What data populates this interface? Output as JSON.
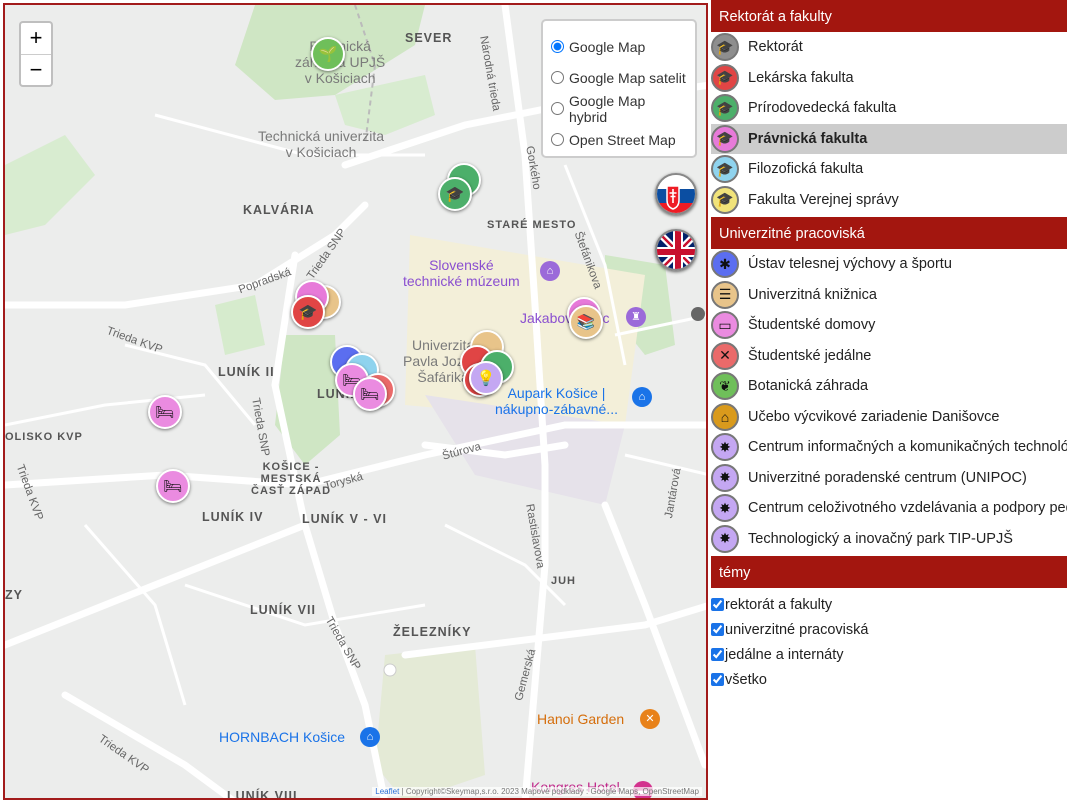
{
  "map": {
    "zoom_in": "+",
    "zoom_out": "−",
    "layers": [
      {
        "label": "Google Map",
        "checked": true
      },
      {
        "label": "Google Map satelit",
        "checked": false
      },
      {
        "label": "Google Map hybrid",
        "checked": false
      },
      {
        "label": "Open Street Map",
        "checked": false
      }
    ],
    "labels": {
      "botanicka": "Botanická\nzáhrada UPJŠ\nv Košiciach",
      "tuke": "Technická univerzita\nv Košiciach",
      "sever": "SEVER",
      "kalvaria": "KALVÁRIA",
      "stare_mesto": "STARÉ MESTO",
      "muzeum": "Slovenské\ntechnické múzeum",
      "jakab": "Jakabov palác",
      "upjs": "Univerzita\nPavla Jozefa\nŠafárika",
      "aupark": "Aupark Košice |\nnákupno-zábavné...",
      "lunik_ii": "LUNÍK II",
      "lunik_iii": "LUNÍK III",
      "kosice_zapad": "KOŠICE -\nMESTSKÁ\nČASŤ ZÁPAD",
      "lunik_iv": "LUNÍK IV",
      "lunik_v_vi": "LUNÍK V - VI",
      "lunik_vii": "LUNÍK VII",
      "zelezniky": "ŽELEZNÍKY",
      "juh": "JUH",
      "lunik_viii": "LUNÍK VIII",
      "hornbach": "HORNBACH Košice",
      "hanoi": "Hanoi Garden",
      "kongres": "Kongres Hotel",
      "olisko": "OLISKO KVP",
      "zy": "ZY",
      "narodna": "Národná trieda",
      "gorkeho": "Gorkého",
      "stefanikova": "Štefánikova",
      "popradska": "Popradská",
      "trieda_snp": "Trieda SNP",
      "trieda_kvp": "Trieda KVP",
      "torysk": "Toryská",
      "sturova": "Štúrova",
      "rastislavova": "Rastislavova",
      "jantarova": "Jantárová",
      "gemerska": "Gemerská",
      "trieda_kvp2": "Trieda KVP"
    },
    "attribution": {
      "leaflet": "Leaflet",
      "text": "| Copyright©Skeymap,s.r.o. 2023   Mapové podklady : Google Maps, OpenStreetMap"
    }
  },
  "sidebar": {
    "sections": [
      {
        "title": "Rektorát  a fakulty",
        "items": [
          {
            "label": "Rektorát",
            "color": "#8e8e8e",
            "icon": "graduation-cap-icon",
            "highlight": false
          },
          {
            "label": "Lekárska fakulta",
            "color": "#e04545",
            "icon": "graduation-cap-icon",
            "highlight": false
          },
          {
            "label": "Prírodovedecká fakulta",
            "color": "#4caf6a",
            "icon": "graduation-cap-icon",
            "highlight": false
          },
          {
            "label": "Právnická fakulta",
            "color": "#e77ad9",
            "icon": "graduation-cap-icon",
            "highlight": true
          },
          {
            "label": "Filozofická fakulta",
            "color": "#8fd3ee",
            "icon": "graduation-cap-icon",
            "highlight": false
          },
          {
            "label": "Fakulta Verejnej správy",
            "color": "#f1e37a",
            "icon": "graduation-cap-icon",
            "highlight": false
          }
        ]
      },
      {
        "title": "Univerzitné pracoviská",
        "items": [
          {
            "label": "Ústav telesnej výchovy a športu",
            "color": "#5b6ef0",
            "icon": "athlete-icon",
            "highlight": false
          },
          {
            "label": "Univerzitná knižnica",
            "color": "#e8c48a",
            "icon": "books-icon",
            "highlight": false
          },
          {
            "label": "Študentské domovy",
            "color": "#ea8be0",
            "icon": "bed-icon",
            "highlight": false
          },
          {
            "label": "Študentské jedálne",
            "color": "#ea6a6a",
            "icon": "cutlery-icon",
            "highlight": false
          },
          {
            "label": "Botanická záhrada",
            "color": "#6fbf5a",
            "icon": "plant-icon",
            "highlight": false
          },
          {
            "label": "Učebo výcvikové zariadenie Danišovce",
            "color": "#d99a1c",
            "icon": "house-icon",
            "highlight": false
          },
          {
            "label": "Centrum informačných a komunikačných technológií",
            "color": "#c4a7f2",
            "icon": "lightbulb-icon",
            "highlight": false
          },
          {
            "label": "Univerzitné poradenské centrum (UNIPOC)",
            "color": "#c4a7f2",
            "icon": "lightbulb-icon",
            "highlight": false
          },
          {
            "label": "Centrum celoživotného vzdelávania a podpory pedagogickej praxe",
            "color": "#c4a7f2",
            "icon": "lightbulb-icon",
            "highlight": false
          },
          {
            "label": "Technologický a inovačný park TIP-UPJŠ",
            "color": "#c4a7f2",
            "icon": "lightbulb-icon",
            "highlight": false
          }
        ]
      }
    ],
    "themes": {
      "title": "témy",
      "items": [
        {
          "label": "rektorát a fakulty",
          "checked": true
        },
        {
          "label": "univerzitné pracoviská",
          "checked": true
        },
        {
          "label": "jedálne a internáty",
          "checked": true
        },
        {
          "label": "všetko",
          "checked": true
        }
      ]
    }
  }
}
